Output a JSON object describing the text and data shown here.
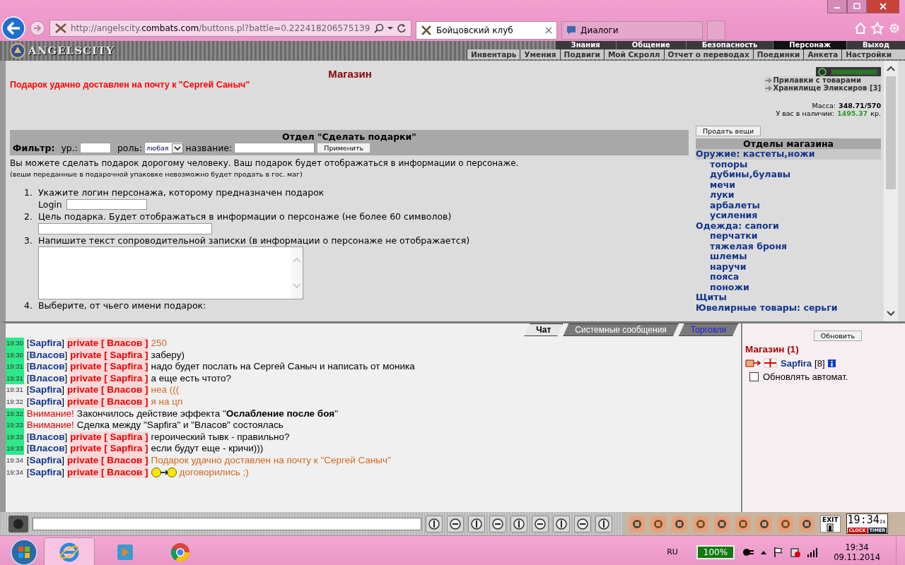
{
  "browser": {
    "url": {
      "host": "http://angelscity.",
      "domain": "combats.com",
      "path": "/buttons.pl?battle=0.222418206575139"
    },
    "tabs": [
      {
        "label": "Бойцовский клуб",
        "selected": true
      },
      {
        "label": "Диалоги",
        "selected": false
      }
    ]
  },
  "game_header": {
    "logo": "ANGELSCITY",
    "top_menu": [
      {
        "label": "Знания",
        "selected": false
      },
      {
        "label": "Общение",
        "selected": false
      },
      {
        "label": "Безопасность",
        "selected": false
      },
      {
        "label": "Персонаж",
        "selected": true
      },
      {
        "label": "Выход",
        "selected": false
      }
    ],
    "sub_menu": [
      "Инвентарь",
      "Умения",
      "Подвиги",
      "Мой Скролл",
      "Отчет о переводах",
      "Поединки",
      "Анкета",
      "Настройки"
    ]
  },
  "shop": {
    "title": "Магазин",
    "notice": "Подарок удачно доставлен на почту к \"Сергей Саныч\"",
    "links": [
      "Прилавки с товарами",
      "Хранилище Эликсиров [3]"
    ],
    "mass_label": "Масса:",
    "mass": "348.71/570",
    "money_label": "У вас в наличии:",
    "money": "1495.37",
    "currency": "кр.",
    "section_title": "Отдел \"Сделать подарки\"",
    "filter": {
      "label": "Фильтр:",
      "level_label": "ур.:",
      "role_label": "роль:",
      "role": "любая",
      "name_label": "название:",
      "apply": "Применить"
    },
    "intro": "Вы можете сделать подарок дорогому человеку. Ваш подарок будет отображаться в информации о персонаже.",
    "note": "(веши переданные в подарочной упаковке невозможно будет продать в гос. маг)",
    "steps": [
      {
        "kind": "login",
        "number": "1.",
        "text": "Укажите логин персонажа, которому предназначен подарок",
        "field_label": "Login"
      },
      {
        "kind": "input",
        "number": "2.",
        "text": "Цель подарка. Будет отображаться в информации о персонаже (не более 60 символов)"
      },
      {
        "kind": "textarea",
        "number": "3.",
        "text": "Напишите текст сопроводительной записки (в информации о персонаже не отображается)"
      },
      {
        "kind": "text",
        "number": "4.",
        "text": "Выберите, от чьего имени подарок:"
      }
    ],
    "sell_button": "Продать вещи",
    "departments_title": "Отделы магазина",
    "departments": [
      {
        "label": "Оружие: кастеты,ножи",
        "selected": true,
        "children": [
          {
            "label": "топоры",
            "selected": false
          },
          {
            "label": "дубины,булавы",
            "selected": false
          },
          {
            "label": "мечи",
            "selected": false
          },
          {
            "label": "луки",
            "selected": false
          },
          {
            "label": "арбалеты",
            "selected": false
          },
          {
            "label": "усиления",
            "selected": false
          }
        ]
      },
      {
        "label": "Одежда: сапоги",
        "selected": false,
        "children": [
          {
            "label": "перчатки",
            "selected": false
          },
          {
            "label": "тяжелая броня",
            "selected": false
          },
          {
            "label": "шлемы",
            "selected": false
          },
          {
            "label": "наручи",
            "selected": false
          },
          {
            "label": "пояса",
            "selected": false
          },
          {
            "label": "поножи",
            "selected": false
          }
        ]
      },
      {
        "label": "Щиты",
        "selected": false
      },
      {
        "label": "Ювелирные товары: серьги",
        "selected": false
      }
    ]
  },
  "chat": {
    "tabs": [
      {
        "label": "Чат",
        "selected": true,
        "highlighted": false
      },
      {
        "label": "Системные сообщения",
        "selected": false,
        "highlighted": false
      },
      {
        "label": "Торговля",
        "selected": false,
        "highlighted": true
      }
    ],
    "messages": [
      {
        "kind": "private",
        "time": "19:30",
        "highlighted": true,
        "sender": "[**Sapfira**]",
        "recipient": "private [ Власов ]",
        "text": "250",
        "to_me": true
      },
      {
        "kind": "private",
        "time": "19:30",
        "highlighted": true,
        "sender": "[**Власов**]",
        "recipient": "private [ Sapfira ]",
        "text": "заберу)",
        "to_me": false
      },
      {
        "kind": "private",
        "time": "19:31",
        "highlighted": true,
        "sender": "[**Власов**]",
        "recipient": "private [ Sapfira ]",
        "text": "надо будет послать на Сергей Саныч и написать от моника",
        "to_me": false
      },
      {
        "kind": "private",
        "time": "19:31",
        "highlighted": true,
        "sender": "[**Власов**]",
        "recipient": "private [ Sapfira ]",
        "text": "а еще есть чтото?",
        "to_me": false
      },
      {
        "kind": "private",
        "time": "19:31",
        "highlighted": false,
        "sender": "[**Sapfira**]",
        "recipient": "private [ Власов ]",
        "text": "неа (((",
        "to_me": true
      },
      {
        "kind": "private",
        "time": "19:32",
        "highlighted": false,
        "sender": "[**Sapfira**]",
        "recipient": "private [ Власов ]",
        "text": "я на цп",
        "to_me": true
      },
      {
        "kind": "system",
        "time": "19:32",
        "highlighted": true,
        "label": "Внимание!",
        "text": "Закончилось действие эффекта \"**Ослабление после боя**\""
      },
      {
        "kind": "system",
        "time": "19:33",
        "highlighted": true,
        "label": "Внимание!",
        "text": "Сделка между \"Sapfira\" и \"Власов\" состоялась"
      },
      {
        "kind": "private",
        "time": "19:33",
        "highlighted": true,
        "sender": "[**Власов**]",
        "recipient": "private [ Sapfira ]",
        "text": "героический тывк - правильно?",
        "to_me": false
      },
      {
        "kind": "private",
        "time": "19:33",
        "highlighted": true,
        "sender": "[**Власов**]",
        "recipient": "private [ Sapfira ]",
        "text": "если будут еще - кричи)))",
        "to_me": false
      },
      {
        "kind": "private",
        "time": "19:34",
        "highlighted": false,
        "sender": "[**Sapfira**]",
        "recipient": "private [ Власов ]",
        "text": "Подарок удачно доставлен на почту к \"Сергей Саныч\"",
        "to_me": true
      },
      {
        "kind": "private_emoticon",
        "time": "19:34",
        "highlighted": false,
        "sender": "[**Sapfira**]",
        "recipient": "private [ Власов ]",
        "text": "договорились ;)",
        "to_me": true
      }
    ],
    "refresh_button": "Обновить",
    "room": "Магазин (1)",
    "users": [
      {
        "name": "Sapfira",
        "level": "[8]"
      }
    ],
    "auto_refresh": {
      "label": "Обновлять автомат.",
      "checked": false
    }
  },
  "toolbar": {
    "exit_label": "EXIT",
    "clock": "19:34",
    "seconds": "24",
    "clock_label": "CLOCK",
    "timer_label": "TIMER"
  },
  "taskbar": {
    "language": "RU",
    "battery": "100%",
    "time": "19:34",
    "date": "09.11.2014"
  }
}
